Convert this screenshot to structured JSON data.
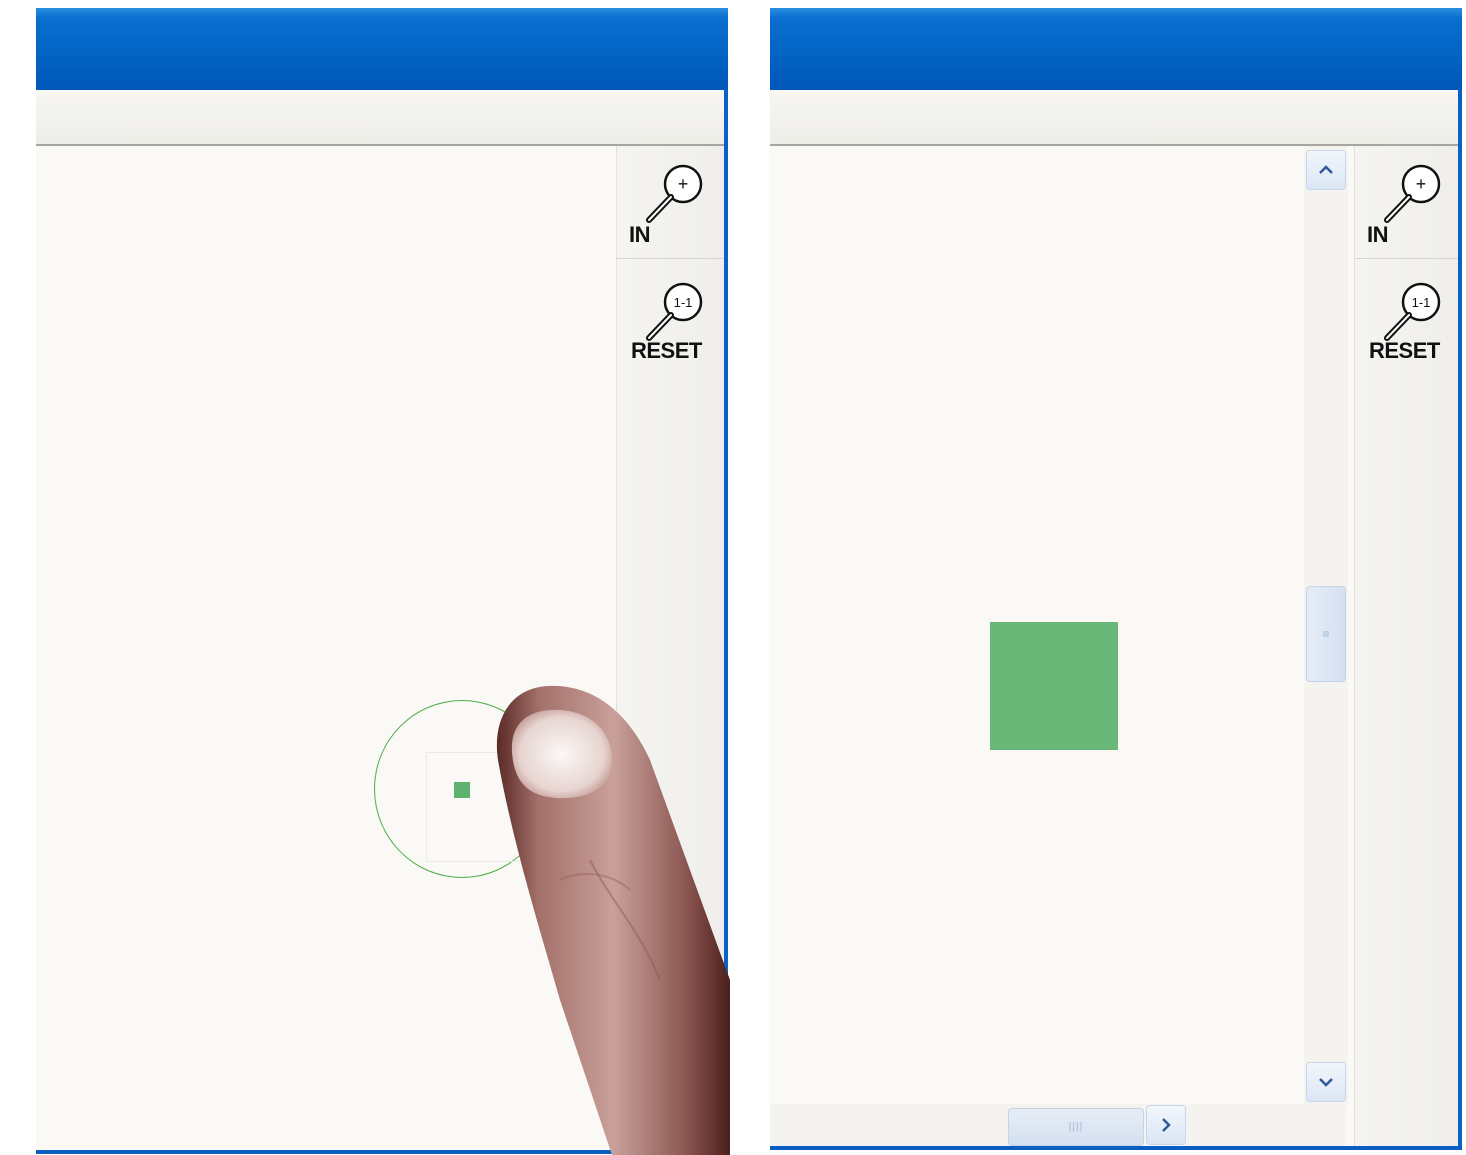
{
  "left_panel": {
    "zoom_in_label": "IN",
    "zoom_in_icon_glyph": "+",
    "reset_label": "RESET",
    "reset_icon_glyph": "1-1",
    "target_color": "#5eb26f",
    "zoom_ring_color": "#4cae4a"
  },
  "right_panel": {
    "zoom_in_label": "IN",
    "zoom_in_icon_glyph": "+",
    "reset_label": "RESET",
    "reset_icon_glyph": "1-1",
    "target_color": "#6ab878",
    "scroll_up_icon": "chevron-up-icon",
    "scroll_down_icon": "chevron-down-icon",
    "scroll_right_icon": "chevron-right-icon"
  },
  "colors": {
    "titlebar": "#0264c4",
    "canvas": "#faf9f6",
    "scrollbar_button": "#dbe6f5"
  }
}
